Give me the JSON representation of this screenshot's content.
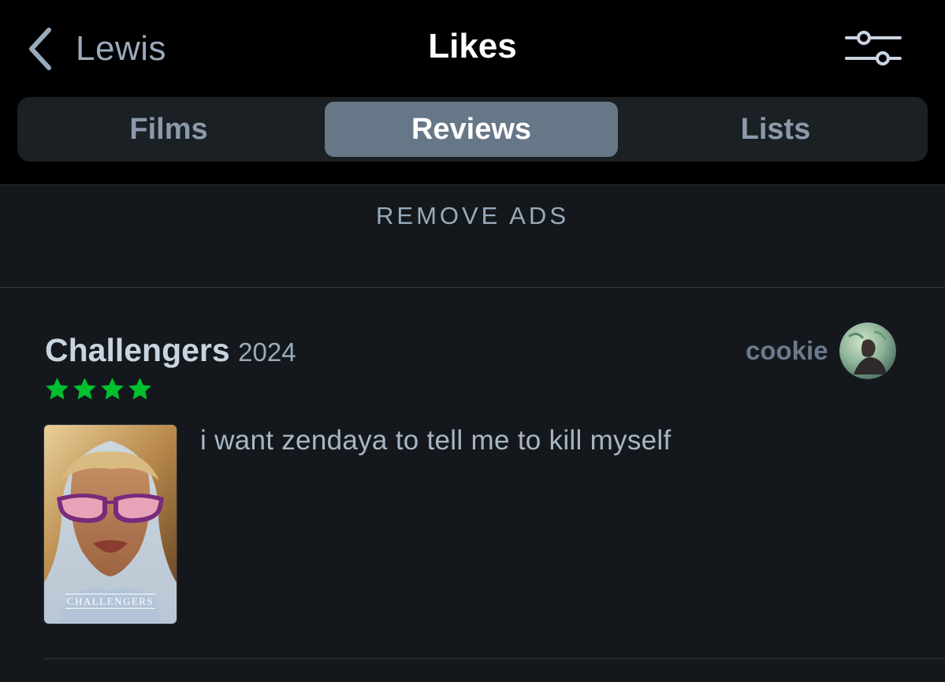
{
  "header": {
    "back_label": "Lewis",
    "title": "Likes",
    "back_icon": "chevron-left-icon",
    "filter_icon": "sliders-icon"
  },
  "tabs": [
    {
      "label": "Films",
      "selected": false
    },
    {
      "label": "Reviews",
      "selected": true
    },
    {
      "label": "Lists",
      "selected": false
    }
  ],
  "remove_ads_label": "REMOVE ADS",
  "review": {
    "film_title": "Challengers",
    "film_year": "2024",
    "rating_stars": 4,
    "star_color": "#00c030",
    "reviewer_name": "cookie",
    "poster_title": "CHALLENGERS",
    "text": "i want zendaya to tell me to kill myself"
  },
  "colors": {
    "background": "#14181c",
    "header_background": "#000000",
    "selected_tab": "#667788",
    "muted_text": "#99aabb"
  }
}
